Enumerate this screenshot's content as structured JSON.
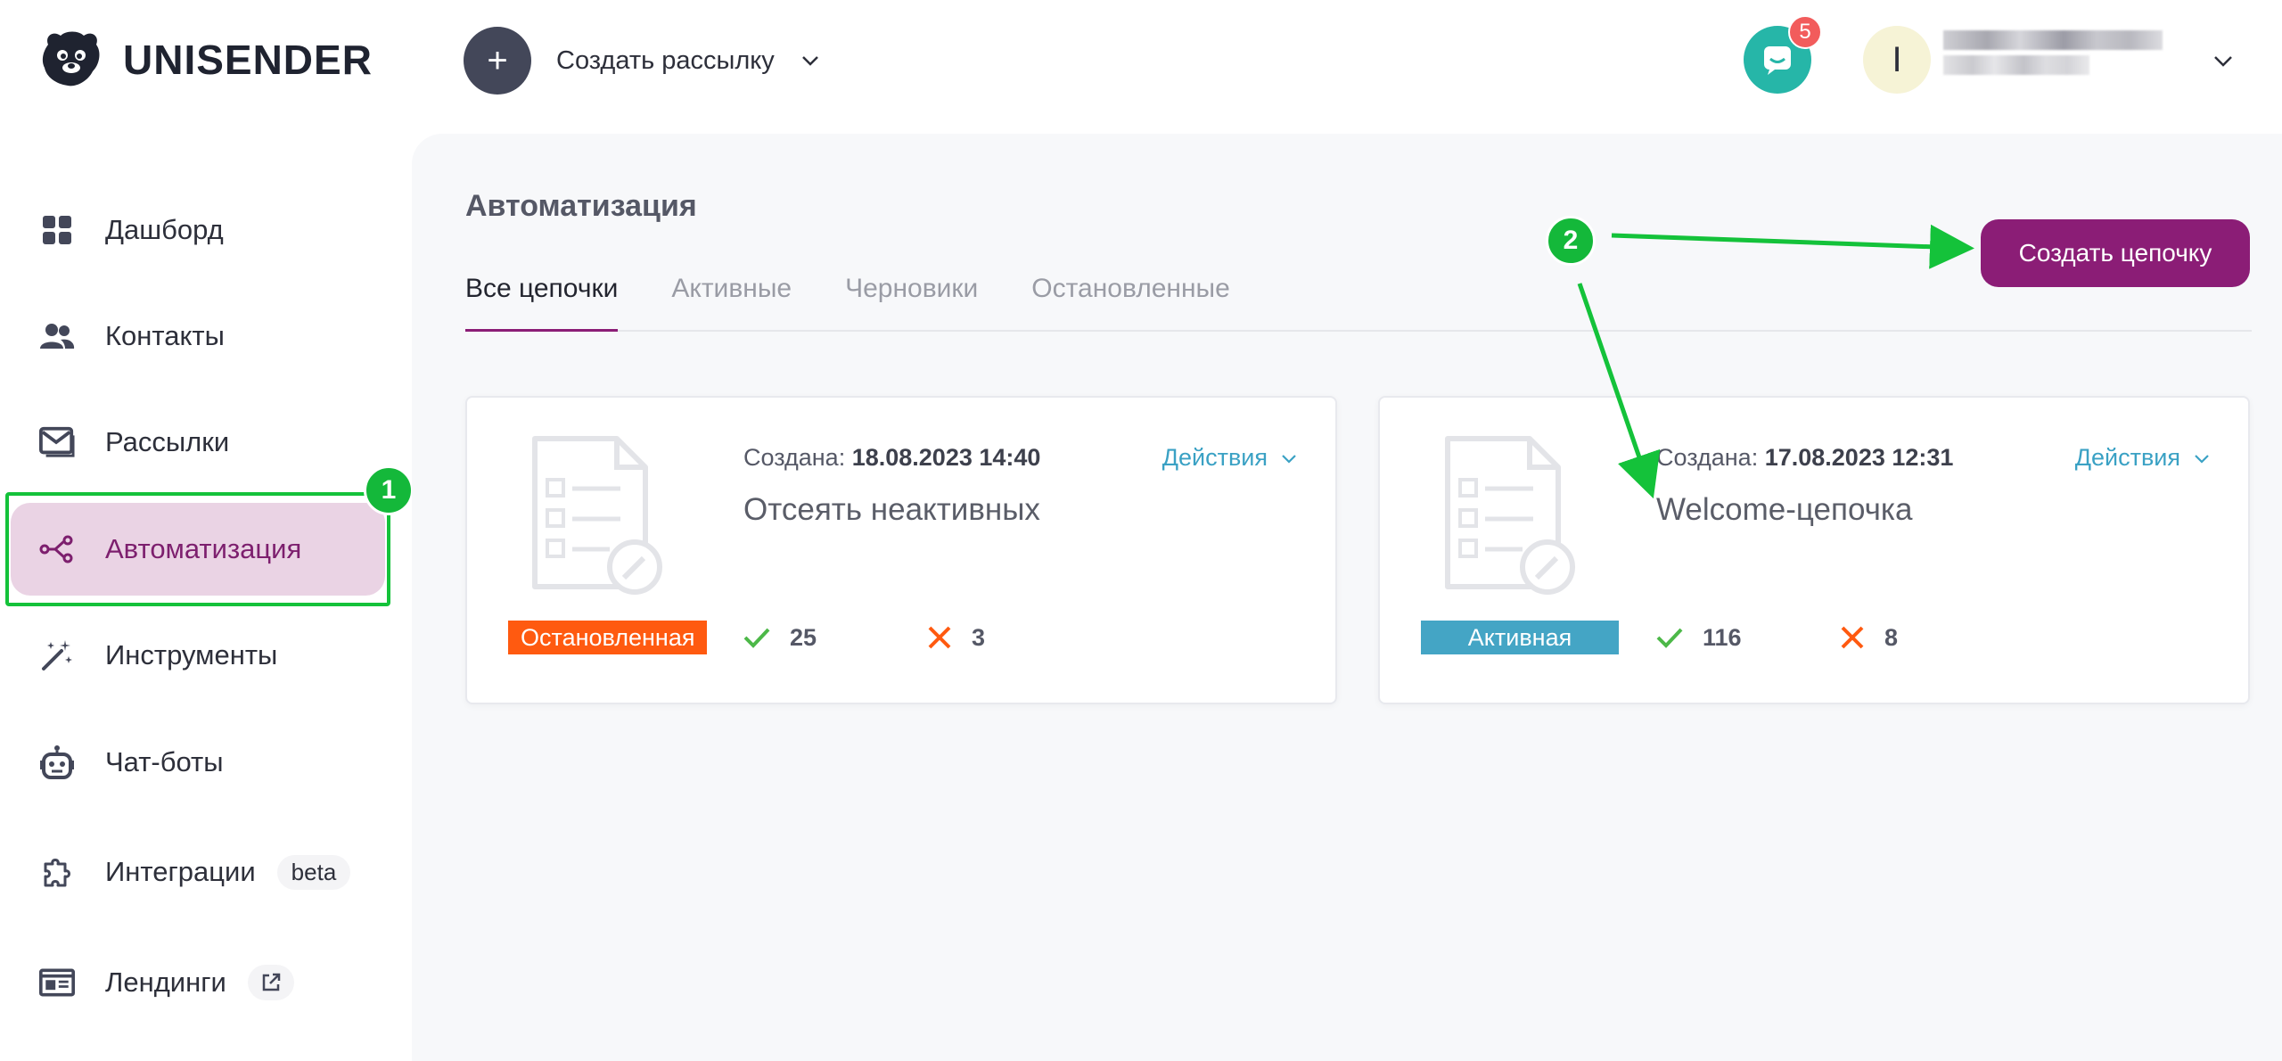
{
  "header": {
    "brand": "UNISENDER",
    "create_mailing_label": "Создать рассылку",
    "chat_badge_count": "5",
    "avatar_letter": "I"
  },
  "sidebar": {
    "items": [
      {
        "label": "Дашборд",
        "icon": "dashboard-icon"
      },
      {
        "label": "Контакты",
        "icon": "contacts-icon"
      },
      {
        "label": "Рассылки",
        "icon": "mail-icon"
      },
      {
        "label": "Автоматизация",
        "icon": "automation-icon",
        "active": true
      },
      {
        "label": "Инструменты",
        "icon": "magic-wand-icon"
      },
      {
        "label": "Чат-боты",
        "icon": "robot-icon"
      },
      {
        "label": "Интеграции",
        "icon": "puzzle-icon",
        "tag": "beta"
      },
      {
        "label": "Лендинги",
        "icon": "landing-icon",
        "external": true
      }
    ]
  },
  "annotations": {
    "step1": "1",
    "step2": "2",
    "color": "#14c23a"
  },
  "main": {
    "title": "Автоматизация",
    "create_chain_label": "Создать цепочку",
    "tabs": [
      {
        "label": "Все цепочки",
        "active": true
      },
      {
        "label": "Активные"
      },
      {
        "label": "Черновики"
      },
      {
        "label": "Остановленные"
      }
    ],
    "cards": [
      {
        "created_label": "Создана:",
        "created_value": "18.08.2023 14:40",
        "name": "Отсеять неактивных",
        "actions_label": "Действия",
        "status": "Остановленная",
        "status_color": "#ff5a10",
        "success_count": "25",
        "fail_count": "3"
      },
      {
        "created_label": "Создана:",
        "created_value": "17.08.2023 12:31",
        "name": "Welcome-цепочка",
        "actions_label": "Действия",
        "status": "Активная",
        "status_color": "#44a5c5",
        "success_count": "116",
        "fail_count": "8"
      }
    ]
  },
  "colors": {
    "brand_accent": "#8b1d76",
    "active_nav_bg": "#ead3e4",
    "link": "#3aa1c4",
    "chat_button": "#26b6a8"
  }
}
